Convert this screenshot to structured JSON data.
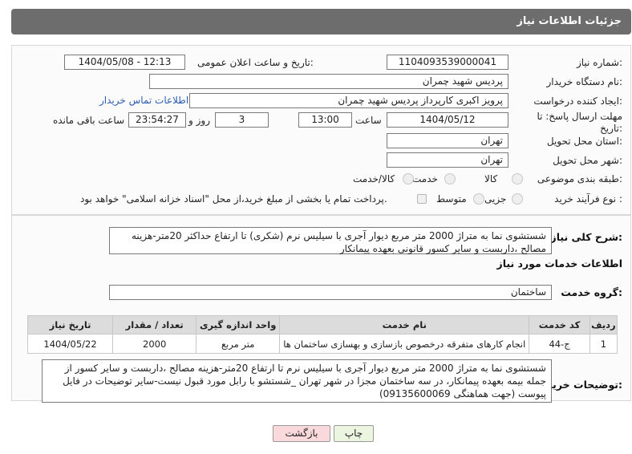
{
  "header": {
    "title": "جزئیات اطلاعات نیاز"
  },
  "fields": {
    "need_number_label": "شماره نیاز:",
    "need_number": "1104093539000041",
    "announce_label": "تاریخ و ساعت اعلان عمومی:",
    "announce_value": "1404/05/08 - 12:13",
    "buyer_org_label": "نام دستگاه خریدار:",
    "buyer_org": "پردیس شهید چمران",
    "requester_label": "ایجاد کننده درخواست:",
    "requester": "پرویز اکبری کارپرداز پردیس شهید چمران",
    "contact_link": "اطلاعات تماس خریدار",
    "deadline_label_1": "مهلت ارسال پاسخ: تا",
    "deadline_label_2": "تاریخ:",
    "deadline_date": "1404/05/12",
    "time_label": "ساعت",
    "deadline_time": "13:00",
    "days_value": "3",
    "days_label": "روز و",
    "remaining_time": "23:54:27",
    "remaining_label": "ساعت باقی مانده",
    "province_label": "استان محل تحویل:",
    "province": "تهران",
    "city_label": "شهر محل تحویل:",
    "city": "تهران",
    "category_label": "طبقه بندی موضوعی:",
    "category_options": [
      "کالا",
      "خدمت",
      "کالا/خدمت"
    ],
    "process_label": "نوع فرآیند خرید :",
    "process_options": [
      "جزیی",
      "متوسط"
    ],
    "payment_note": "پرداخت تمام یا بخشی از مبلغ خرید،از محل \"اسناد خزانه اسلامی\" خواهد بود."
  },
  "summary": {
    "label": "شرح کلی نیاز:",
    "text": "شستشوی نما به متراژ 2000 متر مربع دیوار آجری با سیلیس نرم (شکری) تا ارتفاع حداکثر 20متر-هزینه مصالح ،داربست و سایر کسور قانونی بعهده پیمانکار"
  },
  "services": {
    "section_title": "اطلاعات خدمات مورد نیاز",
    "group_label": "گروه خدمت:",
    "group_value": "ساختمان",
    "columns": [
      "ردیف",
      "کد خدمت",
      "نام خدمت",
      "واحد اندازه گیری",
      "تعداد / مقدار",
      "تاریخ نیاز"
    ],
    "rows": [
      [
        "1",
        "ج-44",
        "انجام کارهای متفرقه درخصوص بازسازی و بهسازی ساختمان ها",
        "متر مربع",
        "2000",
        "1404/05/22"
      ]
    ]
  },
  "buyer_notes": {
    "label": "توضیحات خریدار:",
    "text": "شستشوی نما به متراژ 2000 متر مربع دیوار آجری با سیلیس نرم تا ارتفاع 20متر-هزینه مصالح ،داربست و سایر کسور از جمله بیمه بعهده پیمانکار، در سه ساختمان مجزا در شهر تهران _شستشو با رابل مورد قبول نیست-سایر توضیحات در فایل پیوست (جهت هماهنگی 09135600069)"
  },
  "buttons": {
    "print": "چاپ",
    "back": "بازگشت"
  },
  "colors": {
    "header_bg": "#6d6d6d",
    "back_button_bg": "#f9d9dc",
    "link": "#2a5db0"
  }
}
